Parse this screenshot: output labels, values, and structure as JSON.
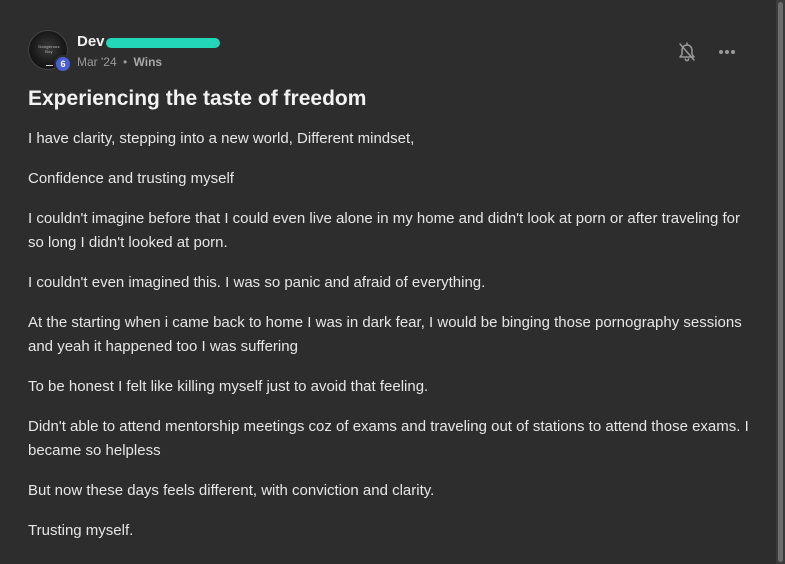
{
  "post": {
    "author": {
      "name": "Dev",
      "level": "6",
      "avatar_text": "Dangerous Boy"
    },
    "meta": {
      "date": "Mar '24",
      "separator": "•",
      "category": "Wins"
    },
    "title": "Experiencing the taste of freedom",
    "paragraphs": [
      "I have clarity, stepping into a new world, Different mindset,",
      "Confidence and trusting myself",
      "I couldn't imagine before that I could even live alone in my home and didn't look at porn or after traveling for so long I didn't looked at porn.",
      "I couldn't even imagined this. I was so panic and afraid of everything.",
      "At the starting when i came back to home I was in dark fear, I would be binging those pornography sessions and yeah it happened too I was suffering",
      "To be honest I felt like killing myself just to avoid that feeling.",
      "Didn't able to attend mentorship meetings coz of exams and traveling out of stations to attend those exams. I became so helpless",
      "But now these days feels different, with conviction and clarity.",
      "Trusting myself."
    ]
  },
  "icons": {
    "bell": "bell-off-icon",
    "more": "more-horizontal-icon"
  },
  "colors": {
    "background": "#2d2d2d",
    "text": "#e6e6e6",
    "muted": "#9a9a9a",
    "badge": "#4a5ed6",
    "redaction": "#23d6b8"
  }
}
